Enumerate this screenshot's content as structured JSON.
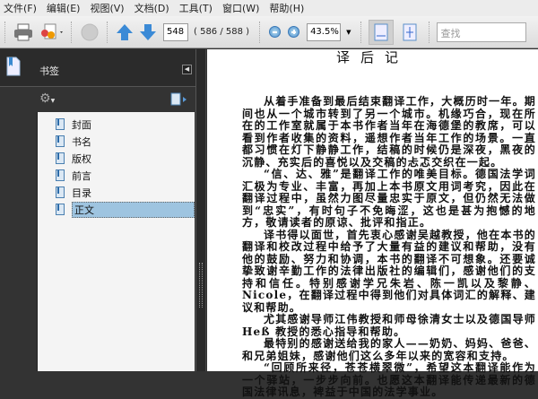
{
  "menu": [
    "文件(F)",
    "编辑(E)",
    "视图(V)",
    "文档(D)",
    "工具(T)",
    "窗口(W)",
    "帮助(H)"
  ],
  "toolbar": {
    "page_number": "548",
    "page_count": "( 586 / 588 )",
    "zoom": "43.5%",
    "search_placeholder": "查找"
  },
  "bookmarks": {
    "title": "书签",
    "items": [
      "封面",
      "书名",
      "版权",
      "前言",
      "目录",
      "正文"
    ],
    "selected": "正文"
  },
  "document": {
    "title": "译后记",
    "paragraphs": [
      "从着手准备到最后结束翻译工作，大概历时一年。期间也从一个城市转到了另一个城市。机缘巧合，现在所在的工作室就属于本书作者当年在海德堡的教席，可以看到作者收集的资料，遥想作者当年工作的场景。一直都习惯在灯下静静工作，结稿的时候仍是深夜，黑夜的沉静、充实后的喜悦以及交稿的忐忑交织在一起。",
      "“信、达、雅”是翻译工作的唯美目标。德国法学词汇极为专业、丰富，再加上本书原文用词考究，因此在翻译过程中，虽然力图尽量忠实于原文，但仍然无法做到“忠实”，有时句子不免晦涩，这也是甚为抱憾的地方，敬请读者的原谅、批评和指正。",
      "译书得以面世，首先衷心感谢吴越教授，他在本书的翻译和校改过程中给予了大量有益的建议和帮助，没有他的鼓励、努力和协调，本书的翻译不可想象。还要诚挚致谢辛勤工作的法律出版社的编辑们，感谢他们的支持和信任。特别感谢学兄朱岩、陈一凯以及黎静、Nicole，在翻译过程中得到他们对具体词汇的解释、建议和帮助。",
      "尤其感谢导师江伟教授和师母徐清女士以及德国导师 Heß 教授的悉心指导和帮助。",
      "最特别的感谢送给我的家人——奶奶、妈妈、爸爸、和兄弟姐妹，感谢他们这么多年以来的宽容和支持。",
      "“回顾所来径，苍苍横翠微”，希望这本翻译能作为一个驿站，一步步向前。也愿这本翻译能传递最新的德国法律讯息，裨益于中国的法学事业。"
    ]
  }
}
